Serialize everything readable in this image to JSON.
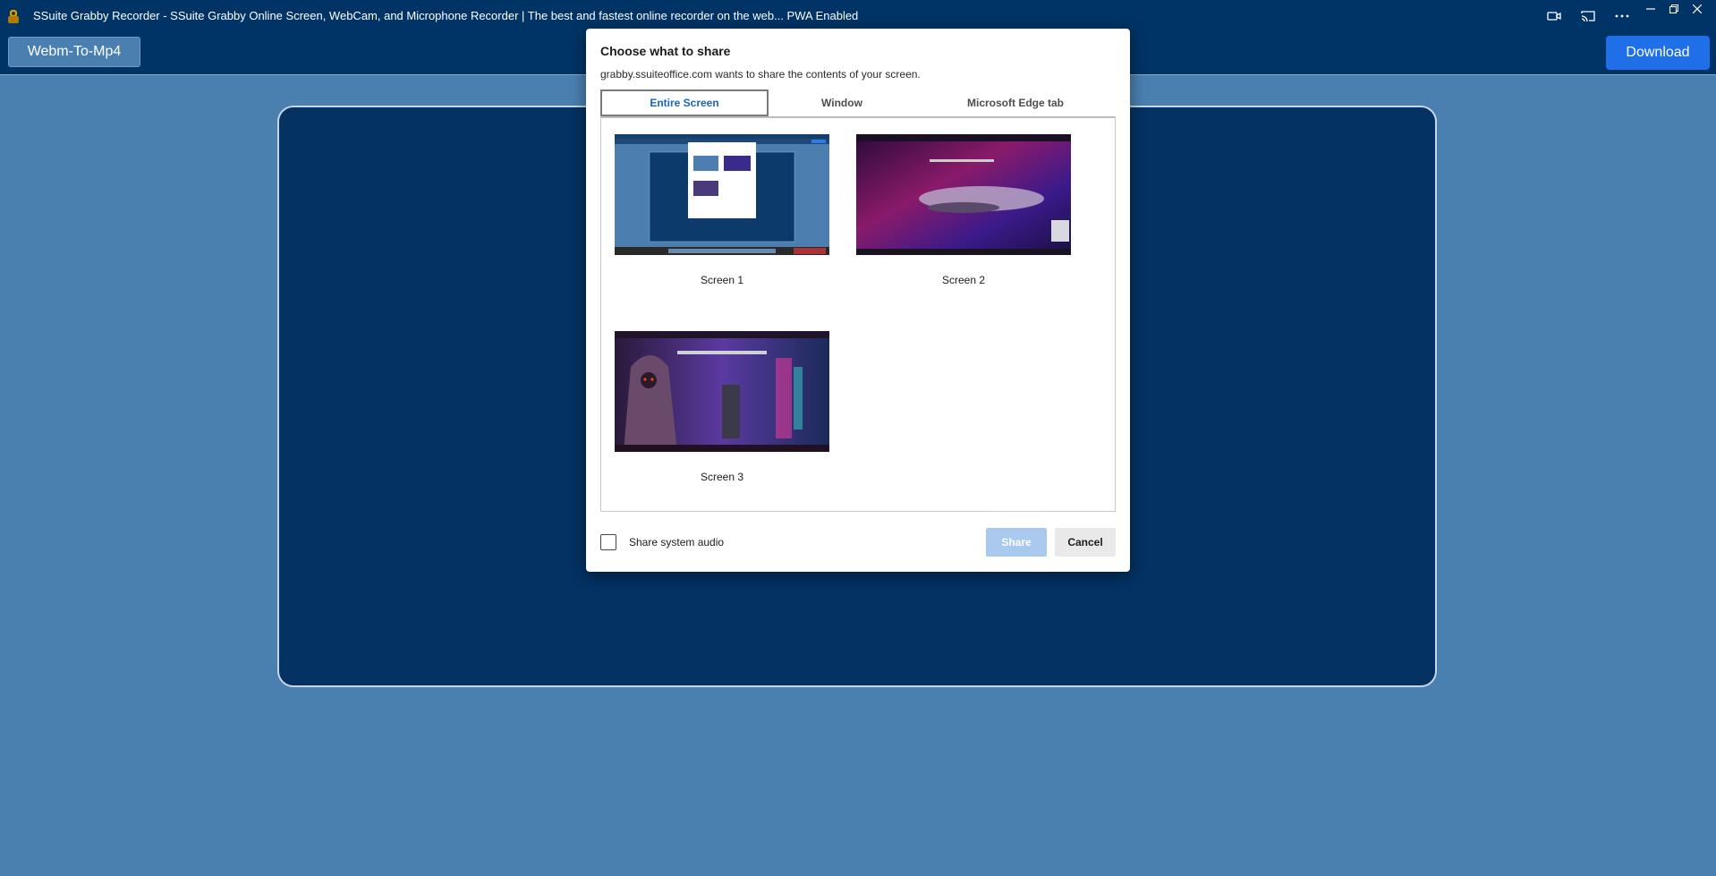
{
  "window": {
    "title": "SSuite Grabby Recorder - SSuite Grabby Online Screen, WebCam, and Microphone Recorder | The best and fastest online recorder on the web... PWA Enabled",
    "icons": [
      "camera-icon",
      "cast-icon",
      "more-options-icon",
      "minimize-icon",
      "restore-icon",
      "close-icon"
    ]
  },
  "toolbar": {
    "webm_label": "Webm-To-Mp4",
    "download_label": "Download"
  },
  "dialog": {
    "title": "Choose what to share",
    "subtitle": "grabby.ssuiteoffice.com wants to share the contents of your screen.",
    "tabs": [
      {
        "label": "Entire Screen",
        "active": true
      },
      {
        "label": "Window",
        "active": false
      },
      {
        "label": "Microsoft Edge tab",
        "active": false
      }
    ],
    "screens": [
      {
        "label": "Screen 1"
      },
      {
        "label": "Screen 2"
      },
      {
        "label": "Screen 3"
      }
    ],
    "audio_label": "Share system audio",
    "audio_checked": false,
    "share_label": "Share",
    "cancel_label": "Cancel"
  },
  "colors": {
    "page_bg": "#4a80b0",
    "bar_bg": "#003466",
    "stage_bg": "#043263",
    "accent": "#1a63c8",
    "download": "#1e6fe8"
  }
}
